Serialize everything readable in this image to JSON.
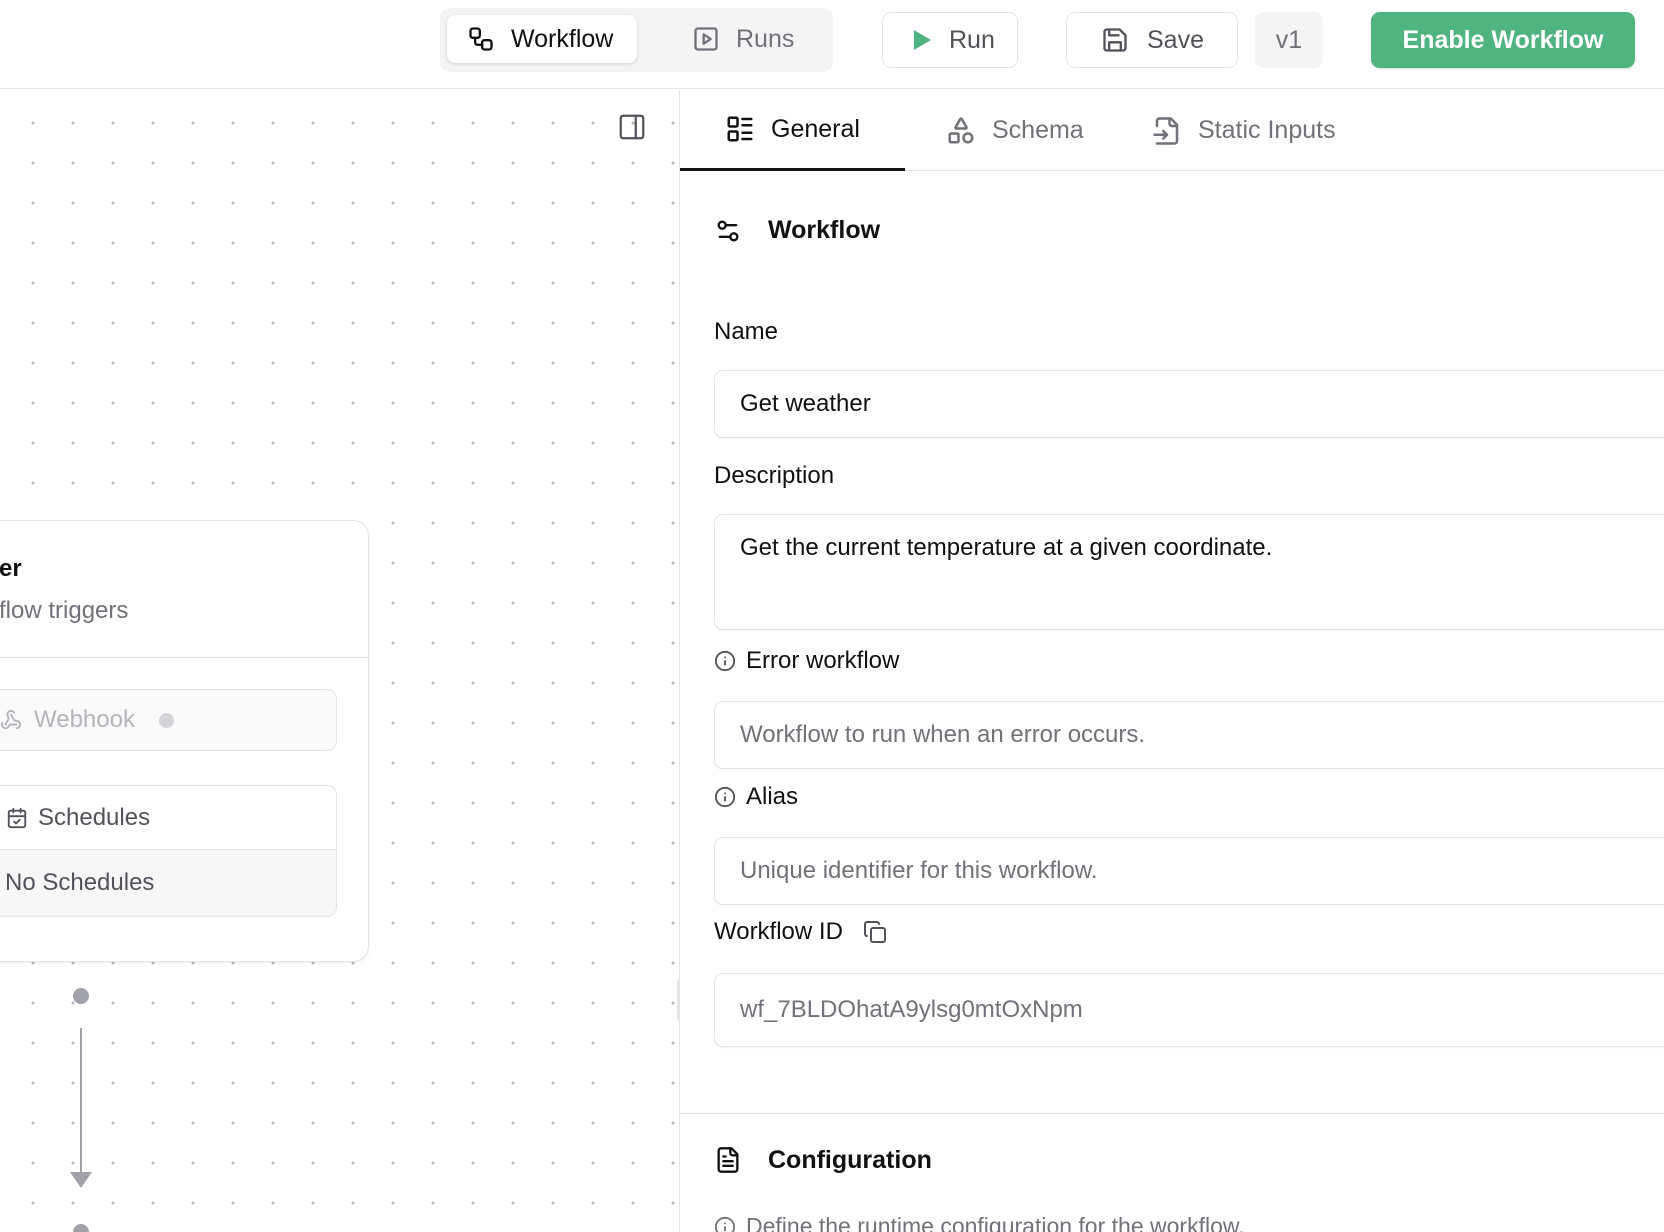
{
  "topbar": {
    "workflow_tab": "Workflow",
    "runs_tab": "Runs",
    "run_label": "Run",
    "save_label": "Save",
    "version": "v1",
    "enable_label": "Enable Workflow",
    "enable_color": "#4fb47f",
    "run_icon_color": "#4fb47f"
  },
  "canvas": {
    "node": {
      "title_fragment": "er",
      "subtitle_fragment": "flow triggers",
      "webhook_label": "Webhook",
      "schedules_label": "Schedules",
      "schedules_empty": "No Schedules"
    }
  },
  "panel": {
    "tabs": [
      {
        "label": "General",
        "icon": "list-layout-icon"
      },
      {
        "label": "Schema",
        "icon": "shapes-icon"
      },
      {
        "label": "Static Inputs",
        "icon": "file-input-icon"
      }
    ],
    "workflow_section": {
      "title": "Workflow",
      "name_label": "Name",
      "name_value": "Get weather",
      "description_label": "Description",
      "description_value": "Get the current temperature at a given coordinate.",
      "error_workflow_label": "Error workflow",
      "error_workflow_placeholder": "Workflow to run when an error occurs.",
      "alias_label": "Alias",
      "alias_placeholder": "Unique identifier for this workflow.",
      "workflow_id_label": "Workflow ID",
      "workflow_id_value": "wf_7BLDOhatA9ylsg0mtOxNpm"
    },
    "configuration_section": {
      "title": "Configuration",
      "helper": "Define the runtime configuration for the workflow."
    }
  }
}
